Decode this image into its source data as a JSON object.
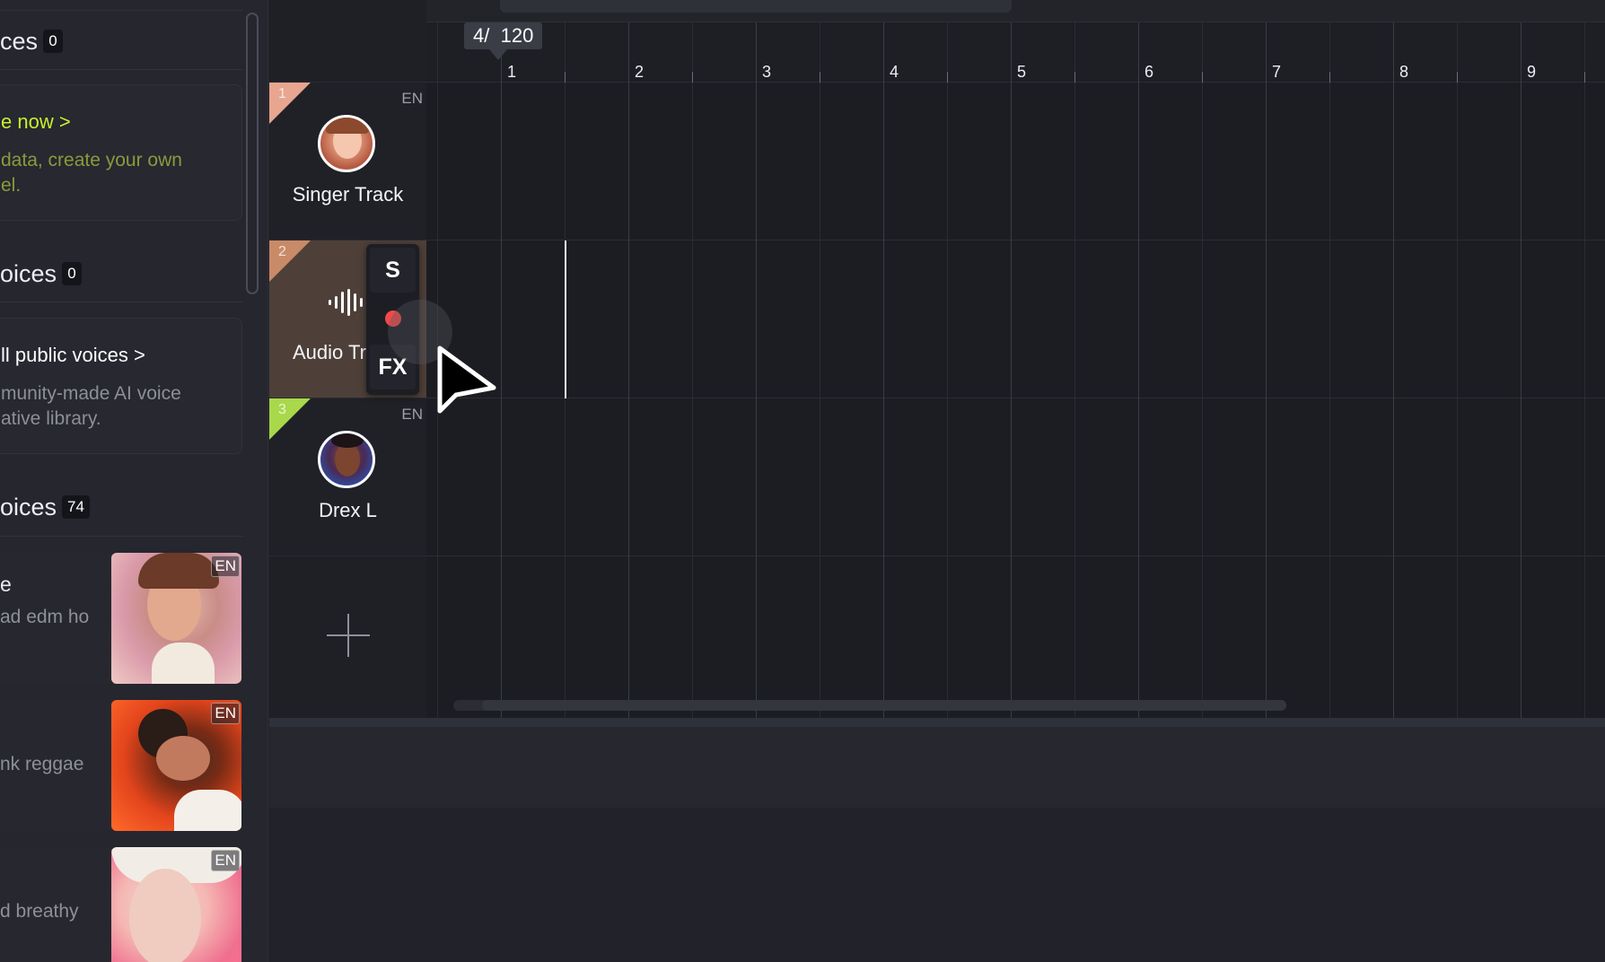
{
  "voice_panel": {
    "my_voices": {
      "title": "ces",
      "count": "0"
    },
    "create_card": {
      "link": "e now >",
      "desc_line1": "data, create your own",
      "desc_line2": "el."
    },
    "public_voices": {
      "title": "oices",
      "count": "0"
    },
    "public_card": {
      "link": "ll public voices >",
      "desc_line1": "munity-made AI voice",
      "desc_line2": "ative library."
    },
    "all_voices": {
      "title": "oices",
      "count": "74"
    },
    "voices": [
      {
        "title": "e",
        "subtitle": "ad edm ho",
        "lang": "EN"
      },
      {
        "title": "",
        "subtitle": "nk reggae",
        "lang": "EN"
      },
      {
        "title": "",
        "subtitle": "d breathy",
        "lang": "EN"
      }
    ]
  },
  "tracks": [
    {
      "number": "1",
      "name": "Singer Track",
      "lang": "EN",
      "color": "#e8a58f"
    },
    {
      "number": "2",
      "name": "Audio Tr",
      "lang": "",
      "color": "#c98a68"
    },
    {
      "number": "3",
      "name": "Drex L",
      "lang": "EN",
      "color": "#a9d84a"
    }
  ],
  "track_toolbar": {
    "solo_label": "S",
    "fx_label": "FX"
  },
  "timeline": {
    "time_signature": "4/",
    "tempo": "120",
    "bars": [
      "1",
      "2",
      "3",
      "4",
      "5",
      "6",
      "7",
      "8",
      "9"
    ]
  },
  "colors": {
    "accent_green": "#c7f02d",
    "record_red": "#ef4a4a"
  }
}
